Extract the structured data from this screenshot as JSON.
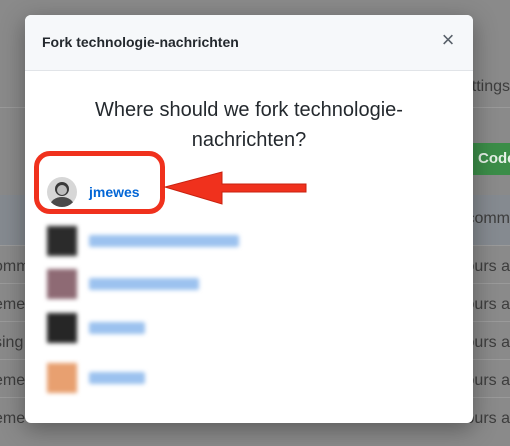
{
  "background": {
    "tab_fragment": "ttings",
    "code_button": "Code",
    "rows_left": [
      "omm",
      "eme",
      "sing",
      "eme",
      "eme"
    ],
    "header_right": "comm",
    "rows_right": [
      "ours a",
      "ours a",
      "ours a",
      "ours a",
      "ours a"
    ]
  },
  "modal": {
    "title": "Fork technologie-nachrichten",
    "close_label": "×",
    "question": "Where should we fork technologie-nachrichten?",
    "owner_selected": "jmewes"
  },
  "colors": {
    "link": "#0366d6",
    "callout": "#f0311d",
    "code_button": "#3b8d48"
  },
  "icons": {
    "close": "close-icon",
    "arrow": "arrow-left-icon"
  }
}
